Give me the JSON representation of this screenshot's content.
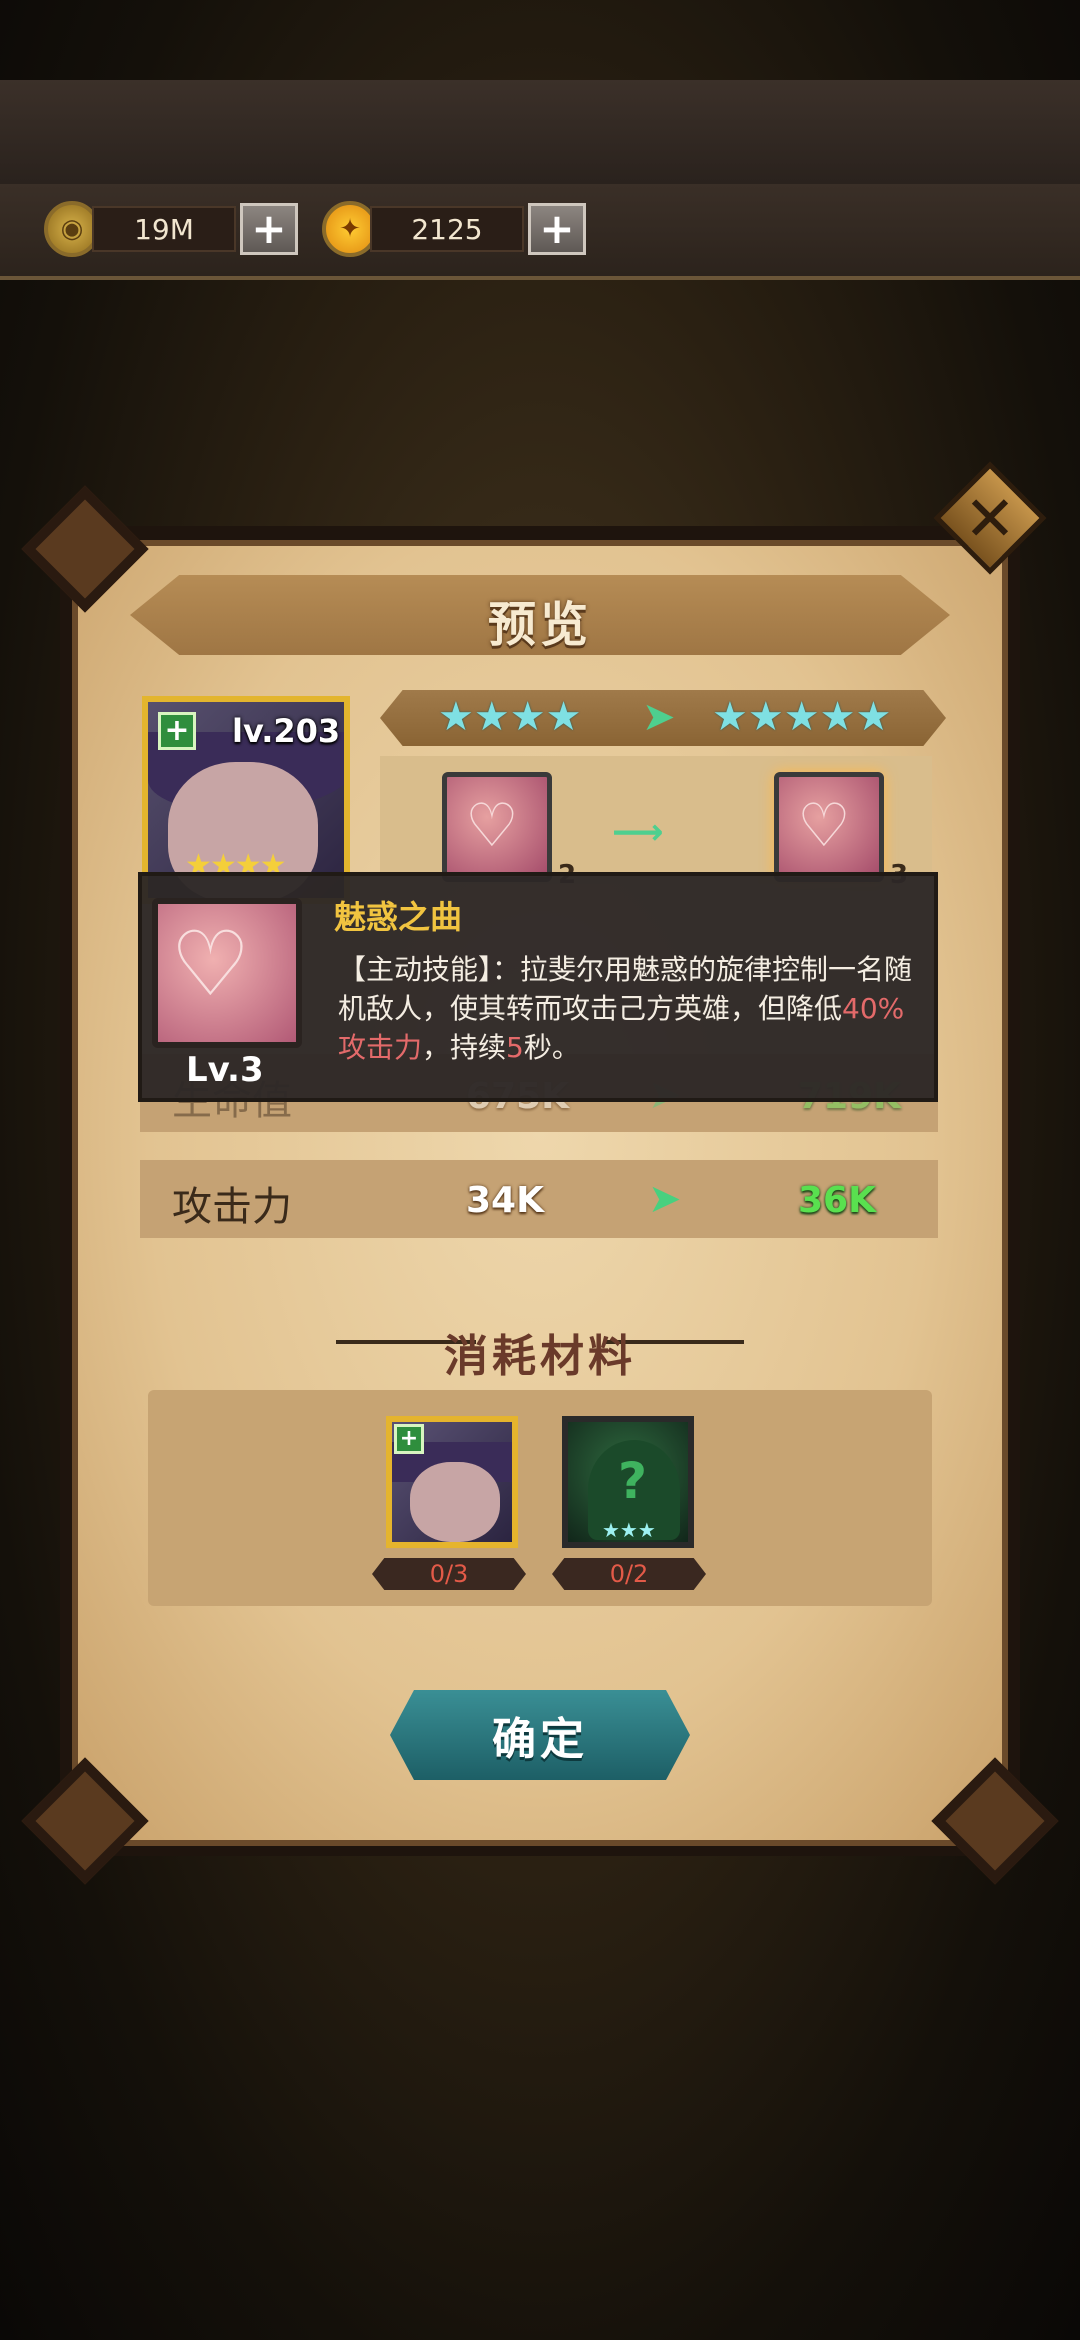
{
  "currency": {
    "gold": {
      "icon": "gold-coin-icon",
      "value": "19M"
    },
    "gem": {
      "icon": "orange-gem-icon",
      "value": "2125"
    }
  },
  "dialog": {
    "title": "预览",
    "hero": {
      "level": "lv.203",
      "stars": "★★★★"
    },
    "star_upgrade": {
      "from": "★★★★",
      "to": "★★★★★"
    },
    "skill_levels": {
      "from": "2",
      "to": "3"
    },
    "tooltip": {
      "name": "魅惑之曲",
      "level": "Lv.3",
      "desc_part1": "【主动技能】：拉斐尔用魅惑的旋律控制一名随机敌人，使其转而攻击己方英雄，但降低",
      "desc_hl1": "40%攻击力",
      "desc_part2": "，持续",
      "desc_hl2": "5",
      "desc_part3": "秒。"
    },
    "stats": [
      {
        "label": "生命值",
        "current": "675K",
        "next": "719K"
      },
      {
        "label": "攻击力",
        "current": "34K",
        "next": "36K"
      }
    ],
    "materials_title": "消耗材料",
    "materials": [
      {
        "count": "0/3",
        "stars": ""
      },
      {
        "count": "0/2",
        "stars": "★★★"
      }
    ],
    "confirm_label": "确定"
  },
  "colors": {
    "accent_green": "#59e04f",
    "highlight_red": "#e36a6a",
    "tooltip_title": "#f1c440"
  }
}
